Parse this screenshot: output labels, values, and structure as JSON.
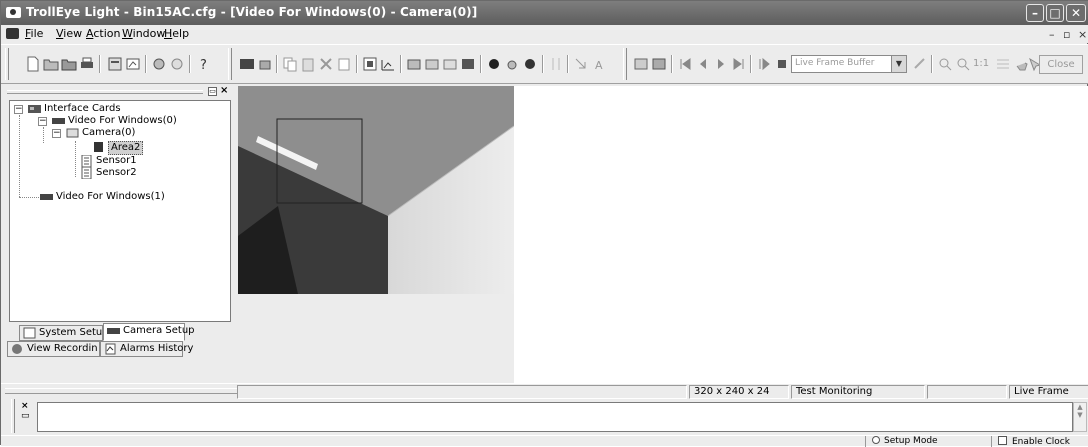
{
  "window": {
    "title": "TrollEye Light - Bin15AC.cfg - [Video For Windows(0) - Camera(0)]"
  },
  "menu": {
    "file": "File",
    "view": "View",
    "action": "Action",
    "window": "Window",
    "help": "Help"
  },
  "toolbar": {
    "frame_source_value": "Live Frame Buffer",
    "close_label": "Close",
    "zoom_label": "1:1"
  },
  "tree": {
    "root": "Interface Cards",
    "card0": "Video For Windows(0)",
    "camera": "Camera(0)",
    "area": "Area2",
    "sensor1": "Sensor1",
    "sensor2": "Sensor2",
    "card1": "Video For Windows(1)"
  },
  "tabs": {
    "system_setup": "System Setup",
    "camera_setup": "Camera Setup",
    "view_recordings": "View Recordin",
    "alarms_history": "Alarms History"
  },
  "status": {
    "resolution": "320 x 240 x 24",
    "monitoring": "Test Monitoring",
    "empty": "",
    "frame_mode": "Live Frame"
  },
  "bottombar": {
    "setup_mode": "Setup Mode",
    "enable_clock": "Enable Clock"
  },
  "colors": {
    "titlebar": "#6a6a6a",
    "selection": "#d0d0d0"
  }
}
